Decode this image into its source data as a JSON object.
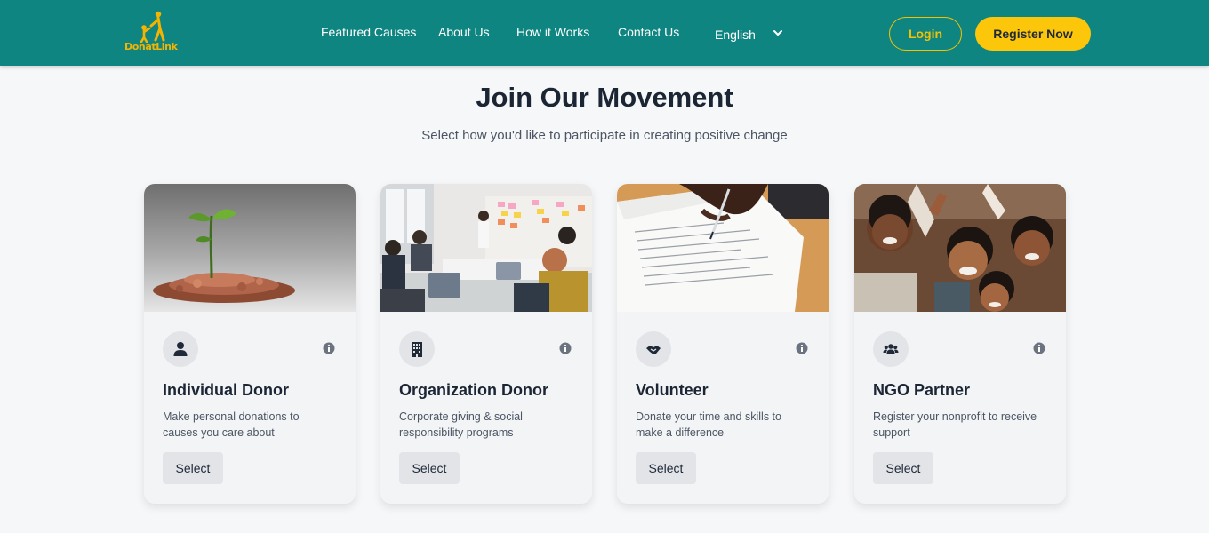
{
  "header": {
    "logo_text": "DonatLink",
    "nav": [
      "Featured Causes",
      "About Us",
      "How it Works",
      "Contact Us"
    ],
    "language": "English",
    "login_label": "Login",
    "register_label": "Register Now"
  },
  "main": {
    "title": "Join Our Movement",
    "subtitle": "Select how you'd like to participate in creating positive change"
  },
  "cards": [
    {
      "icon": "user-icon",
      "title": "Individual Donor",
      "desc": "Make personal donations to causes you care about",
      "button": "Select"
    },
    {
      "icon": "building-icon",
      "title": "Organization Donor",
      "desc": "Corporate giving & social responsibility programs",
      "button": "Select"
    },
    {
      "icon": "handshake-icon",
      "title": "Volunteer",
      "desc": "Donate your time and skills to make a difference",
      "button": "Select"
    },
    {
      "icon": "users-icon",
      "title": "NGO Partner",
      "desc": "Register your nonprofit to receive support",
      "button": "Select"
    }
  ],
  "colors": {
    "header_bg": "#0f8581",
    "accent": "#fcc60a",
    "page_bg": "#f6f7f9"
  }
}
